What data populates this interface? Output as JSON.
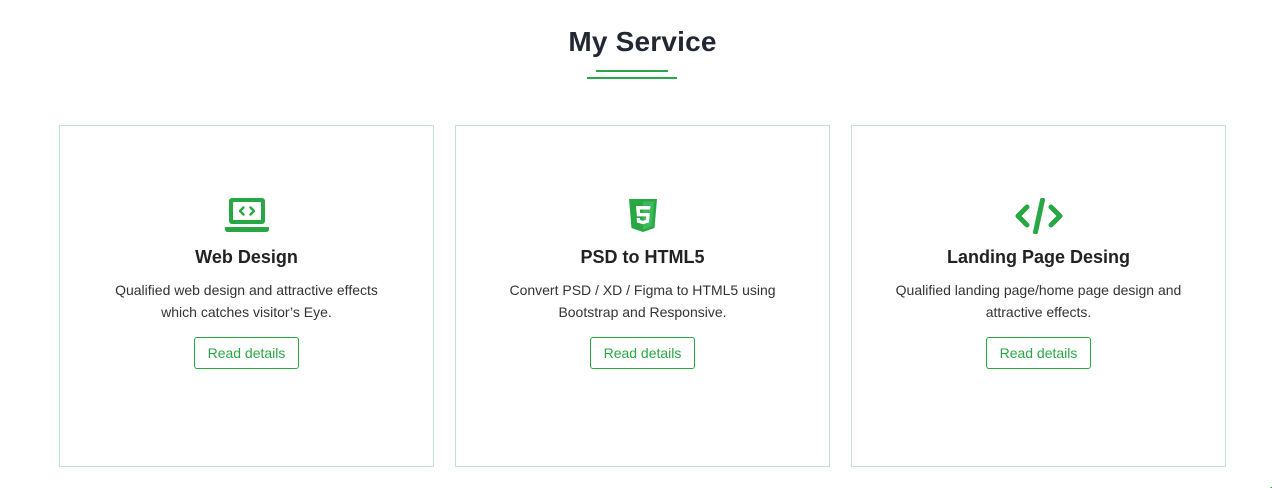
{
  "section": {
    "title": "My Service"
  },
  "accent_color": "#28a745",
  "card_border_color": "#bfe3cb",
  "services": [
    {
      "icon": "laptop-code-icon",
      "title": "Web Design",
      "description": "Qualified web design and attractive effects which catches visitor’s Eye.",
      "button_label": "Read details"
    },
    {
      "icon": "html5-icon",
      "title": "PSD to HTML5",
      "description": "Convert PSD / XD / Figma to HTML5 using Bootstrap and Responsive.",
      "button_label": "Read details"
    },
    {
      "icon": "code-icon",
      "title": "Landing Page Desing",
      "description": "Qualified landing page/home page design and attractive effects.",
      "button_label": "Read details"
    }
  ]
}
